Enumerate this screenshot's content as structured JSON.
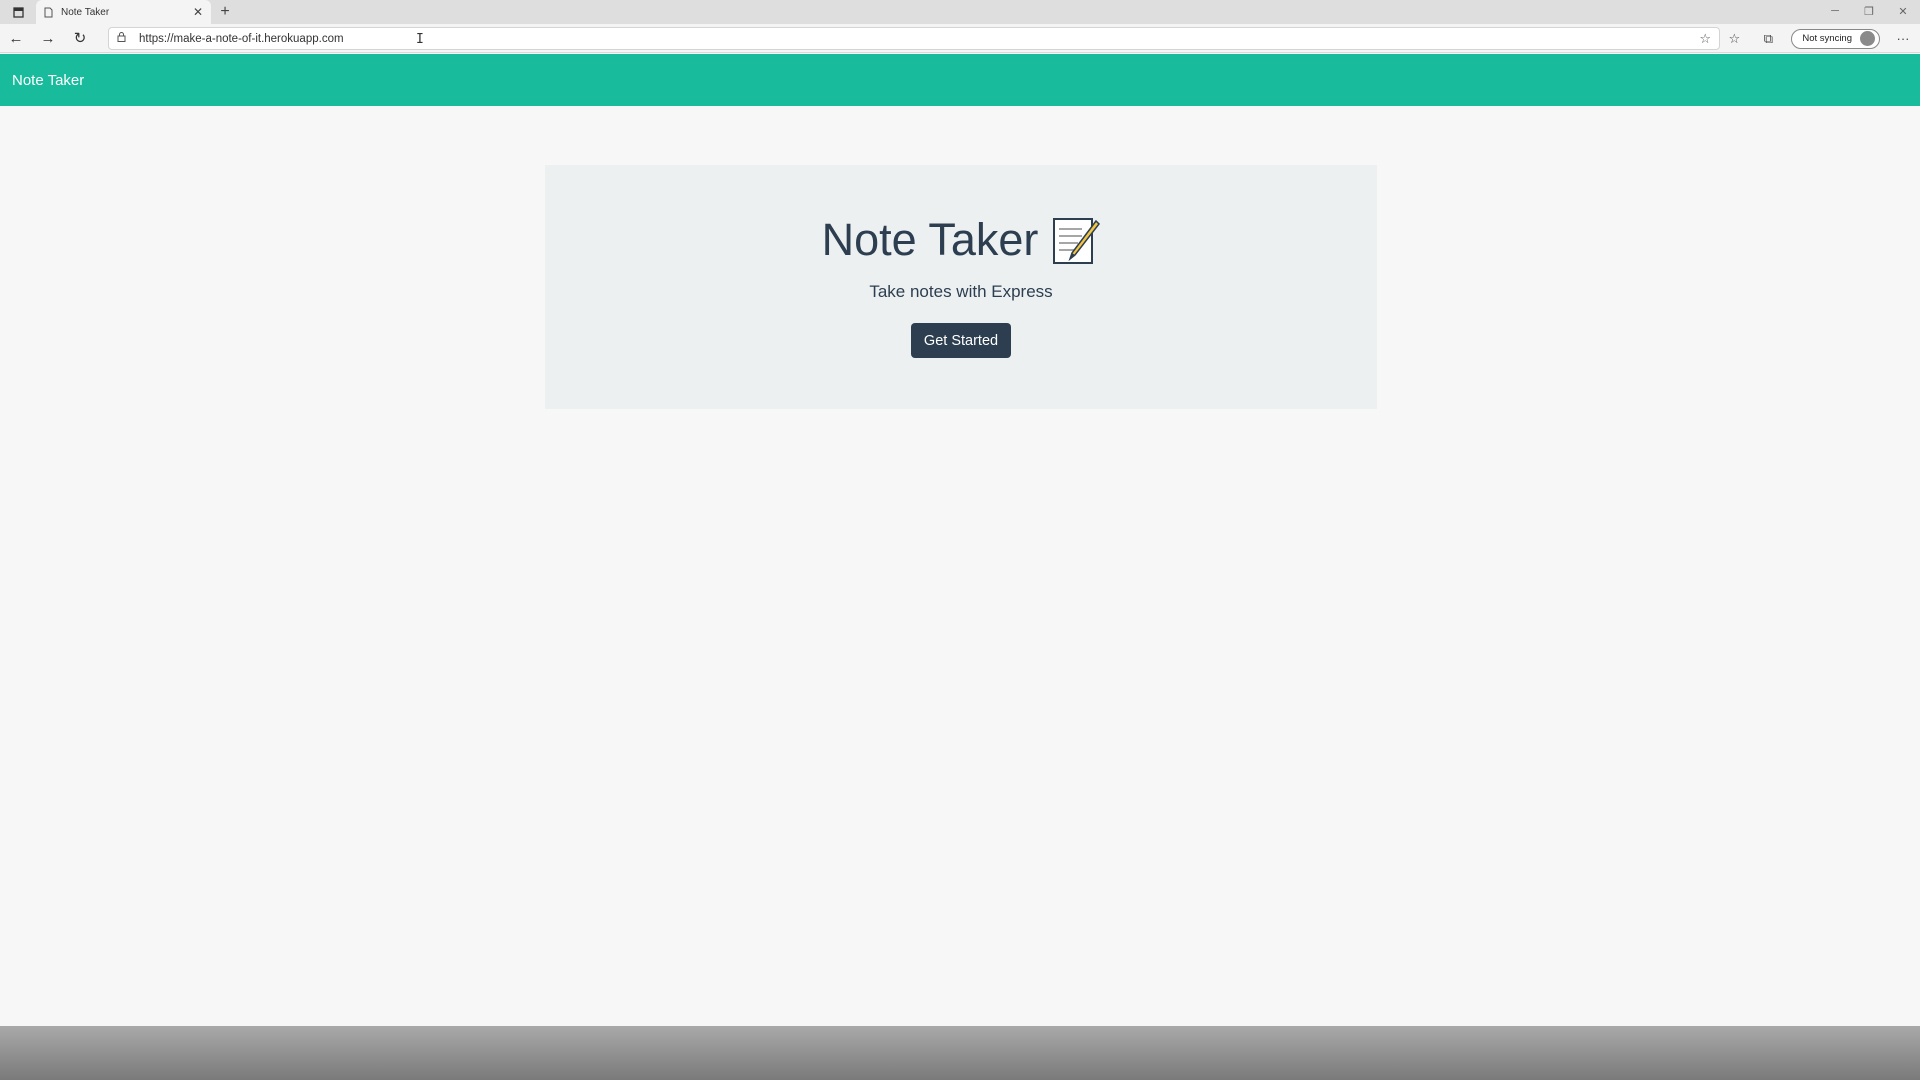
{
  "browser": {
    "tab_title": "Note Taker",
    "tab_close": "✕",
    "new_tab": "+",
    "url": "https://make-a-note-of-it.herokuapp.com",
    "profile_label": "Not syncing"
  },
  "app": {
    "brand": "Note Taker",
    "jumbotron": {
      "title": "Note Taker",
      "subtitle": "Take notes with Express",
      "cta": "Get Started"
    }
  },
  "colors": {
    "navbar": "#18bc9c",
    "primary_dark": "#2c3e50",
    "jumbotron_bg": "#ecf0f1"
  },
  "icons": {
    "title_icon": "memo-icon"
  }
}
